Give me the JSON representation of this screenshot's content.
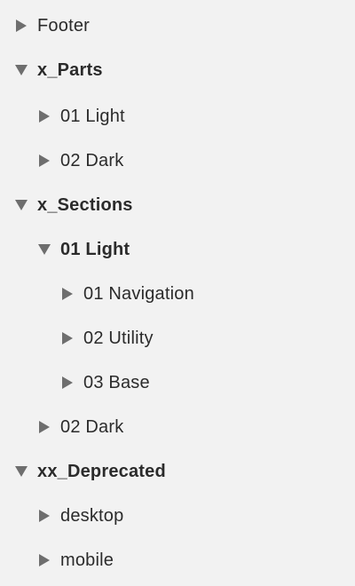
{
  "tree": {
    "items": [
      {
        "label": "Footer",
        "expanded": false,
        "bold": false,
        "depth": 0,
        "icon": "triangle-right-icon"
      },
      {
        "label": "x_Parts",
        "expanded": true,
        "bold": true,
        "depth": 0,
        "icon": "triangle-down-icon"
      },
      {
        "label": "01 Light",
        "expanded": false,
        "bold": false,
        "depth": 1,
        "icon": "triangle-right-icon"
      },
      {
        "label": "02 Dark",
        "expanded": false,
        "bold": false,
        "depth": 1,
        "icon": "triangle-right-icon"
      },
      {
        "label": "x_Sections",
        "expanded": true,
        "bold": true,
        "depth": 0,
        "icon": "triangle-down-icon"
      },
      {
        "label": "01 Light",
        "expanded": true,
        "bold": true,
        "depth": 1,
        "icon": "triangle-down-icon"
      },
      {
        "label": "01 Navigation",
        "expanded": false,
        "bold": false,
        "depth": 2,
        "icon": "triangle-right-icon"
      },
      {
        "label": "02 Utility",
        "expanded": false,
        "bold": false,
        "depth": 2,
        "icon": "triangle-right-icon"
      },
      {
        "label": "03 Base",
        "expanded": false,
        "bold": false,
        "depth": 2,
        "icon": "triangle-right-icon"
      },
      {
        "label": "02 Dark",
        "expanded": false,
        "bold": false,
        "depth": 1,
        "icon": "triangle-right-icon"
      },
      {
        "label": "xx_Deprecated",
        "expanded": true,
        "bold": true,
        "depth": 0,
        "icon": "triangle-down-icon"
      },
      {
        "label": "desktop",
        "expanded": false,
        "bold": false,
        "depth": 1,
        "icon": "triangle-right-icon"
      },
      {
        "label": "mobile",
        "expanded": false,
        "bold": false,
        "depth": 1,
        "icon": "triangle-right-icon"
      }
    ]
  },
  "colors": {
    "background": "#f2f2f2",
    "text": "#2b2b2b",
    "disclosure": "#6e6e6e"
  }
}
